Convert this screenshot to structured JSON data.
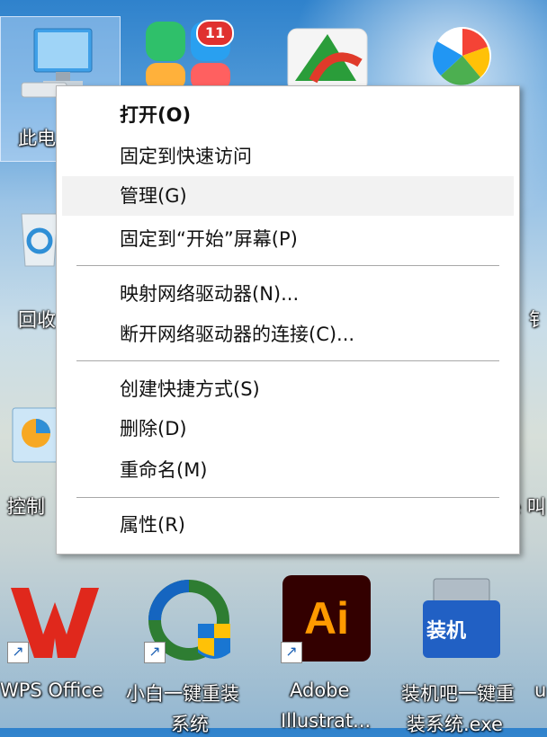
{
  "desktop": {
    "icons": [
      {
        "id": "this-pc",
        "label": "此电"
      },
      {
        "id": "recycle-bin",
        "label": "回收"
      },
      {
        "id": "control-panel",
        "label": "控制"
      },
      {
        "id": "wps-office",
        "label": "WPS Office"
      },
      {
        "id": "xiaobai",
        "label": "小白一键重装",
        "label2": "系统"
      },
      {
        "id": "adobe-illustrator",
        "label": "Adobe",
        "label2": "Illustrat..."
      },
      {
        "id": "zhuangjiba",
        "label": "装机吧一键重",
        "label2": "装系统.exe"
      }
    ],
    "badge_count": "11",
    "right_edge_fragments": [
      "钅",
      "e 叫",
      "u"
    ],
    "ai_text": "Ai",
    "zhuangjiba_text": "装机"
  },
  "context_menu": {
    "items": [
      {
        "label": "打开(O)",
        "bold": true
      },
      {
        "label": "固定到快速访问"
      },
      {
        "label": "管理(G)",
        "hover": true
      },
      {
        "label": "固定到“开始”屏幕(P)"
      },
      {
        "label": "映射网络驱动器(N)..."
      },
      {
        "label": "断开网络驱动器的连接(C)..."
      },
      {
        "label": "创建快捷方式(S)"
      },
      {
        "label": "删除(D)"
      },
      {
        "label": "重命名(M)"
      },
      {
        "label": "属性(R)"
      }
    ]
  }
}
